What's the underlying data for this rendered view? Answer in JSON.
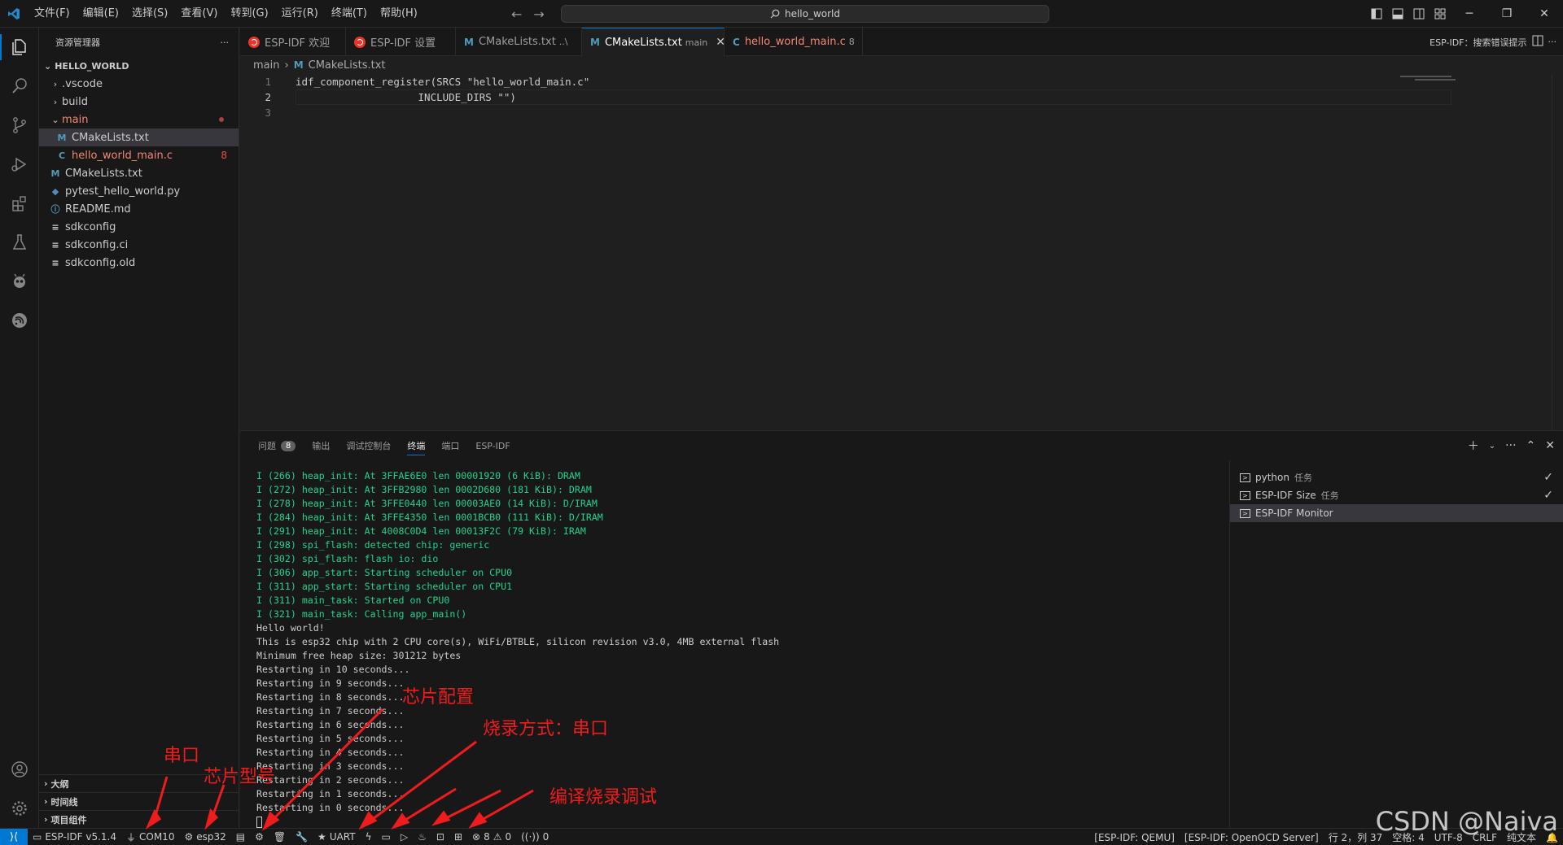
{
  "menu": [
    "文件(F)",
    "编辑(E)",
    "选择(S)",
    "查看(V)",
    "转到(G)",
    "运行(R)",
    "终端(T)",
    "帮助(H)"
  ],
  "search": {
    "text": "hello_world"
  },
  "sidebar": {
    "title": "资源管理器",
    "root": "HELLO_WORLD",
    "items": [
      {
        "label": ".vscode",
        "type": "folder"
      },
      {
        "label": "build",
        "type": "folder"
      },
      {
        "label": "main",
        "type": "folder-open"
      },
      {
        "label": "CMakeLists.txt",
        "type": "cmake"
      },
      {
        "label": "hello_world_main.c",
        "type": "c",
        "errors": "8"
      },
      {
        "label": "CMakeLists.txt",
        "type": "cmake"
      },
      {
        "label": "pytest_hello_world.py",
        "type": "python"
      },
      {
        "label": "README.md",
        "type": "info"
      },
      {
        "label": "sdkconfig",
        "type": "text"
      },
      {
        "label": "sdkconfig.ci",
        "type": "text"
      },
      {
        "label": "sdkconfig.old",
        "type": "text"
      }
    ],
    "bottom_sections": [
      "大纲",
      "时间线",
      "项目组件"
    ]
  },
  "tabs": [
    {
      "label": "ESP-IDF 欢迎",
      "icon": "esp-idf-logo"
    },
    {
      "label": "ESP-IDF 设置",
      "icon": "esp-idf-logo"
    },
    {
      "label": "CMakeLists.txt",
      "desc": "..\\",
      "icon": "cmake-icon"
    },
    {
      "label": "CMakeLists.txt",
      "desc": "main",
      "icon": "cmake-icon",
      "active": true
    },
    {
      "label": "hello_world_main.c",
      "desc": "8",
      "icon": "c-icon"
    }
  ],
  "tabs_right": {
    "label": "ESP-IDF：搜索错误提示"
  },
  "breadcrumb": {
    "folder": "main",
    "file": "CMakeLists.txt"
  },
  "code": [
    {
      "n": "1",
      "text": "idf_component_register(SRCS \"hello_world_main.c\""
    },
    {
      "n": "2",
      "text": "                    INCLUDE_DIRS \"\")"
    },
    {
      "n": "3",
      "text": ""
    }
  ],
  "panel_tabs": [
    {
      "label": "问题",
      "badge": "8"
    },
    {
      "label": "输出"
    },
    {
      "label": "调试控制台"
    },
    {
      "label": "终端",
      "active": true
    },
    {
      "label": "端口"
    },
    {
      "label": "ESP-IDF"
    }
  ],
  "terminal_lines": [
    {
      "text": "I (266) heap_init: At 3FFAE6E0 len 00001920 (6 KiB): DRAM",
      "green": true
    },
    {
      "text": "I (272) heap_init: At 3FFB2980 len 0002D680 (181 KiB): DRAM",
      "green": true
    },
    {
      "text": "I (278) heap_init: At 3FFE0440 len 00003AE0 (14 KiB): D/IRAM",
      "green": true
    },
    {
      "text": "I (284) heap_init: At 3FFE4350 len 0001BCB0 (111 KiB): D/IRAM",
      "green": true
    },
    {
      "text": "I (291) heap_init: At 4008C0D4 len 00013F2C (79 KiB): IRAM",
      "green": true
    },
    {
      "text": "I (298) spi_flash: detected chip: generic",
      "green": true
    },
    {
      "text": "I (302) spi_flash: flash io: dio",
      "green": true
    },
    {
      "text": "I (306) app_start: Starting scheduler on CPU0",
      "green": true
    },
    {
      "text": "I (311) app_start: Starting scheduler on CPU1",
      "green": true
    },
    {
      "text": "I (311) main_task: Started on CPU0",
      "green": true
    },
    {
      "text": "I (321) main_task: Calling app_main()",
      "green": true
    },
    {
      "text": "Hello world!",
      "green": false
    },
    {
      "text": "This is esp32 chip with 2 CPU core(s), WiFi/BTBLE, silicon revision v3.0, 4MB external flash",
      "green": false
    },
    {
      "text": "Minimum free heap size: 301212 bytes",
      "green": false
    },
    {
      "text": "Restarting in 10 seconds...",
      "green": false
    },
    {
      "text": "Restarting in 9 seconds...",
      "green": false
    },
    {
      "text": "Restarting in 8 seconds...",
      "green": false
    },
    {
      "text": "Restarting in 7 seconds...",
      "green": false
    },
    {
      "text": "Restarting in 6 seconds...",
      "green": false
    },
    {
      "text": "Restarting in 5 seconds...",
      "green": false
    },
    {
      "text": "Restarting in 4 seconds...",
      "green": false
    },
    {
      "text": "Restarting in 3 seconds...",
      "green": false
    },
    {
      "text": "Restarting in 2 seconds...",
      "green": false
    },
    {
      "text": "Restarting in 1 seconds...",
      "green": false
    },
    {
      "text": "Restarting in 0 seconds...",
      "green": false
    }
  ],
  "terminals": [
    {
      "name": "python",
      "sub": "任务",
      "done": true
    },
    {
      "name": "ESP-IDF Size",
      "sub": "任务",
      "done": true
    },
    {
      "name": "ESP-IDF Monitor",
      "sub": "",
      "done": false,
      "selected": true
    }
  ],
  "statusbar": {
    "idf_version": "ESP-IDF v5.1.4",
    "port": "COM10",
    "target": "esp32",
    "flash_method": "UART",
    "errors": "8",
    "warnings": "0",
    "ports_count": "0",
    "qemu": "[ESP-IDF: QEMU]",
    "openocd": "[ESP-IDF: OpenOCD Server]",
    "position": "行 2，列 37",
    "indent": "空格: 4",
    "encoding": "UTF-8",
    "eol": "CRLF",
    "language": "纯文本"
  },
  "annotations": {
    "serial": "串口",
    "chip_model": "芯片型号",
    "chip_config": "芯片配置",
    "flash_method": "烧录方式：串口",
    "build_flash_debug": "编译烧录调试",
    "color": "#ee1c1c"
  },
  "watermark": "CSDN @Naiva",
  "colors": {
    "accent": "#0078d4",
    "terminal_green": "#23d18b",
    "error": "#f14c4c"
  }
}
